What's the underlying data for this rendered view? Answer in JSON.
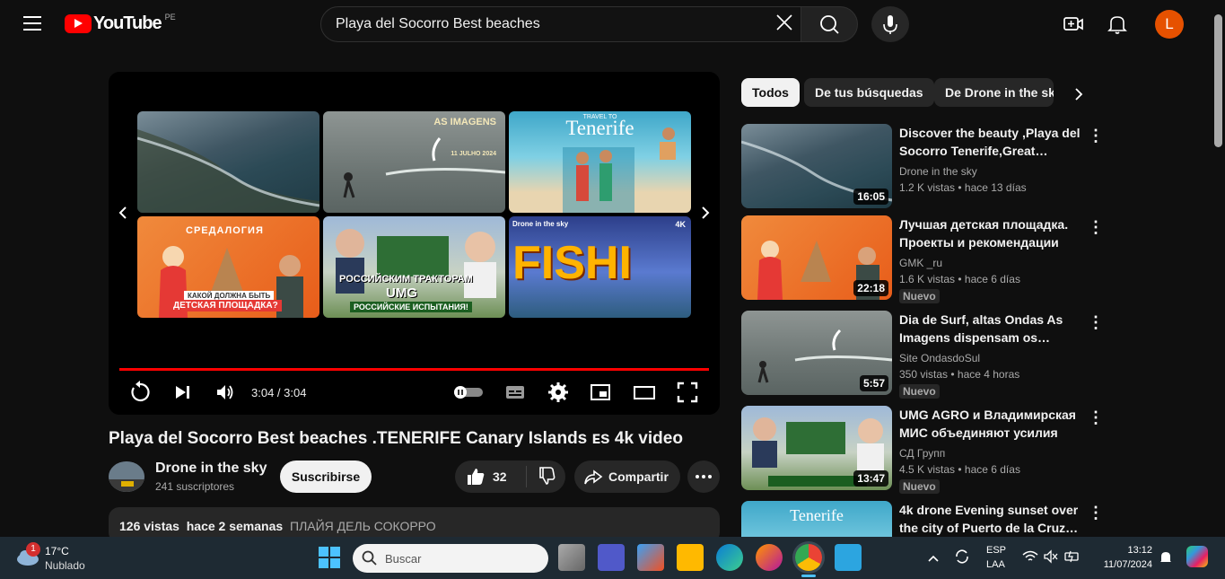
{
  "header": {
    "logo_text": "YouTube",
    "country_code": "PE",
    "search_value": "Playa del Socorro Best beaches",
    "avatar_letter": "L"
  },
  "player": {
    "time": "3:04 / 3:04",
    "progress": 1.0,
    "tiles": [
      {
        "label": "aerial-coast"
      },
      {
        "label": "surf",
        "overlay": "AS IMAGENS",
        "date": "11 JULHO 2024"
      },
      {
        "label": "tenerife",
        "overlay_small": "TRAVEL TO",
        "overlay": "Tenerife"
      },
      {
        "label": "playground",
        "overlay": "СРЕДАЛОГИЯ",
        "caption1": "КАКОЙ ДОЛЖНА БЫТЬ",
        "caption2": "ДЕТСКАЯ ПЛОЩАДКА?"
      },
      {
        "label": "tractor",
        "caption1": "РОССИЙСКИМ ТРАКТОРАМ",
        "caption2": "UMG",
        "caption3": "РОССИЙСКИЕ ИСПЫТАНИЯ!"
      },
      {
        "label": "fishing",
        "overlay_small": "Drone in the sky",
        "overlay": "FISHI",
        "badge": "4K"
      }
    ]
  },
  "video": {
    "title": "Playa del Socorro Best beaches .TENERIFE Canary Islands ᴇs 4k video",
    "channel": "Drone in the sky",
    "subscribers": "241 suscriptores",
    "subscribe_label": "Suscribirse",
    "likes": "32",
    "share_label": "Compartir",
    "views": "126 vistas",
    "date": "hace 2 semanas",
    "hashtag": "ПЛАЙЯ ДЕЛЬ СОКОРРО"
  },
  "chips": [
    "Todos",
    "De tus búsquedas",
    "De Drone in the sky"
  ],
  "recommendations": [
    {
      "title": "Discover the beauty ,Playa del Socorro Tenerife,Great…",
      "channel": "Drone in the sky",
      "meta": "1.2 K vistas  • hace 13 días",
      "duration": "16:05",
      "badge": ""
    },
    {
      "title": "Лучшая детская площадка. Проекты и рекомендации по…",
      "channel": "GMK _ru",
      "meta": "1.6 K vistas  • hace 6 días",
      "duration": "22:18",
      "badge": "Nuevo"
    },
    {
      "title": "Dia de Surf, altas Ondas As Imagens dispensam os…",
      "channel": "Site OndasdoSul",
      "meta": "350 vistas  • hace 4 horas",
      "duration": "5:57",
      "badge": "Nuevo"
    },
    {
      "title": "UMG AGRO и Владимирская МИС объединяют усилия дл…",
      "channel": "СД Групп",
      "meta": "4.5 K vistas  • hace 6 días",
      "duration": "13:47",
      "badge": "Nuevo"
    },
    {
      "title": "4k drone Evening sunset over the city of Puerto de la Cruz…",
      "channel": "",
      "meta": "",
      "duration": "",
      "badge": ""
    }
  ],
  "taskbar": {
    "weather_temp": "17°C",
    "weather_desc": "Nublado",
    "weather_badge": "1",
    "search_placeholder": "Buscar",
    "lang1": "ESP",
    "lang2": "LAA",
    "time": "13:12",
    "date": "11/07/2024"
  }
}
